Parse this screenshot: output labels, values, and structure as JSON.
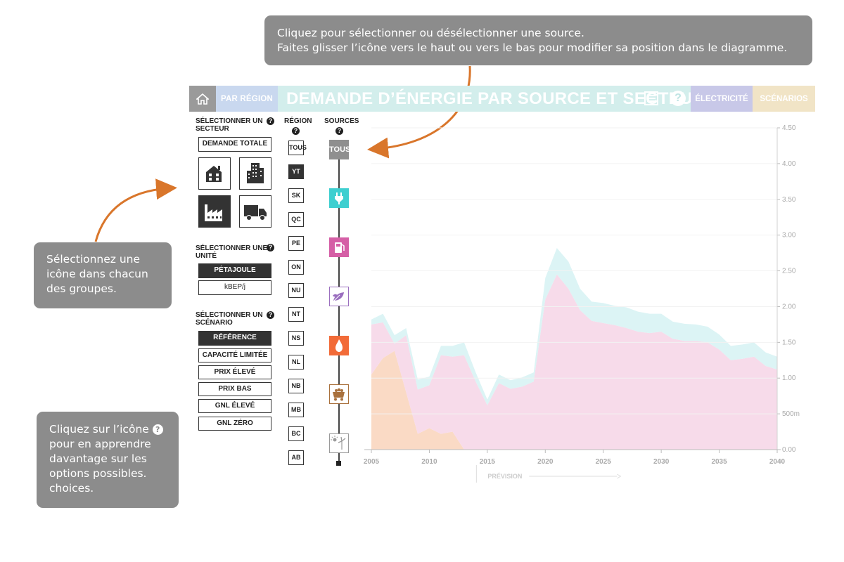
{
  "tooltips": {
    "top": [
      "Cliquez pour sélectionner ou désélectionner une source.",
      "Faites glisser l’icône vers le haut ou vers le bas pour modifier sa position dans le diagramme."
    ],
    "left": [
      "Sélectionnez une",
      "icône dans chacun",
      "des groupes."
    ],
    "bottom_prefix": "Cliquez sur l’icône",
    "bottom_lines": [
      "pour en apprendre",
      "davantage sur les",
      "options possibles.",
      "choices."
    ]
  },
  "header": {
    "region_tab": "PAR RÉGION",
    "title": "DEMANDE D’ÉNERGIE PAR SOURCE ET SECTEUR",
    "electricity_tab": "ÉLECTRICITÉ",
    "scenarios_tab": "SCÉNARIOS"
  },
  "sector": {
    "label_line1": "SÉLECTIONNER UN",
    "label_line2": "SECTEUR",
    "total_button": "DEMANDE TOTALE",
    "icons": [
      "residential-icon",
      "commercial-icon",
      "industrial-icon",
      "transportation-icon"
    ],
    "selected_icon": "industrial-icon"
  },
  "unit": {
    "label_line1": "SÉLECTIONNER UNE",
    "label_line2": "UNITÉ",
    "options": [
      "PÉTAJOULE",
      "kBEP/j"
    ],
    "selected": "PÉTAJOULE"
  },
  "scenario": {
    "label_line1": "SÉLECTIONNER UN",
    "label_line2": "SCÉNARIO",
    "options": [
      "RÉFÉRENCE",
      "CAPACITÉ LIMITÉE",
      "PRIX ÉLEVÉ",
      "PRIX BAS",
      "GNL ÉLEVÉ",
      "GNL ZÉRO"
    ],
    "selected": "RÉFÉRENCE"
  },
  "region": {
    "label": "RÉGION",
    "items": [
      "TOUS",
      "YT",
      "SK",
      "QC",
      "PE",
      "ON",
      "NU",
      "NT",
      "NS",
      "NL",
      "NB",
      "MB",
      "BC",
      "AB"
    ],
    "selected": "YT"
  },
  "sources": {
    "label": "SOURCES",
    "all_label": "TOUS",
    "items": [
      {
        "icon": "electricity-plug-icon",
        "color": "#3ecfd0"
      },
      {
        "icon": "oil-products-icon",
        "color": "#d55fa6"
      },
      {
        "icon": "biofuels-icon",
        "color": "#9b6fbf"
      },
      {
        "icon": "natural-gas-flame-icon",
        "color": "#f26b38"
      },
      {
        "icon": "coal-cart-icon",
        "color": "#a9713d"
      },
      {
        "icon": "renewables-solar-wind-icon",
        "color": "#9a9a9a"
      }
    ]
  },
  "colors": {
    "header_bg": "#d3eeec",
    "tooltip_bg": "#8c8c8c",
    "arrow": "#d9762b"
  },
  "chart_data": {
    "type": "area",
    "x": [
      2005,
      2006,
      2007,
      2008,
      2009,
      2010,
      2011,
      2012,
      2013,
      2014,
      2015,
      2016,
      2017,
      2018,
      2019,
      2020,
      2021,
      2022,
      2023,
      2024,
      2025,
      2026,
      2027,
      2028,
      2029,
      2030,
      2031,
      2032,
      2033,
      2034,
      2035,
      2036,
      2037,
      2038,
      2039,
      2040
    ],
    "series": [
      {
        "color": "#f9d3bb",
        "values": [
          1.05,
          1.28,
          1.38,
          0.8,
          0.22,
          0.3,
          0.22,
          0.25,
          0.0,
          0,
          0,
          0,
          0,
          0,
          0,
          0,
          0,
          0,
          0,
          0,
          0,
          0,
          0,
          0,
          0,
          0,
          0,
          0,
          0,
          0,
          0,
          0,
          0,
          0,
          0,
          0
        ]
      },
      {
        "color": "#f6d5e6",
        "values": [
          0.7,
          0.5,
          0.1,
          0.8,
          0.62,
          0.6,
          1.1,
          1.05,
          1.32,
          0.95,
          0.62,
          0.93,
          0.85,
          0.88,
          0.95,
          2.1,
          2.45,
          2.25,
          1.95,
          1.8,
          1.77,
          1.74,
          1.7,
          1.65,
          1.63,
          1.65,
          1.55,
          1.52,
          1.52,
          1.5,
          1.4,
          1.25,
          1.27,
          1.3,
          1.17,
          1.12
        ]
      },
      {
        "color": "#d6f2f3",
        "values": [
          0.07,
          0.12,
          0.12,
          0.1,
          0.14,
          0.12,
          0.13,
          0.15,
          0.18,
          0.13,
          0.08,
          0.12,
          0.12,
          0.13,
          0.13,
          0.3,
          0.37,
          0.38,
          0.3,
          0.27,
          0.28,
          0.27,
          0.29,
          0.28,
          0.27,
          0.25,
          0.24,
          0.24,
          0.23,
          0.22,
          0.21,
          0.2,
          0.2,
          0.2,
          0.19,
          0.18
        ]
      }
    ],
    "xlim": [
      2005,
      2040
    ],
    "ylim": [
      0,
      4.5
    ],
    "x_ticks": [
      "2005",
      "2010",
      "2015",
      "2020",
      "2025",
      "2030",
      "2035",
      "2040"
    ],
    "y_ticks": [
      "0.00",
      "500m",
      "1.00",
      "1.50",
      "2.00",
      "2.50",
      "3.00",
      "3.50",
      "4.00",
      "4.50"
    ],
    "forecast_label": "PRÉVISION",
    "forecast_start": 2014
  }
}
